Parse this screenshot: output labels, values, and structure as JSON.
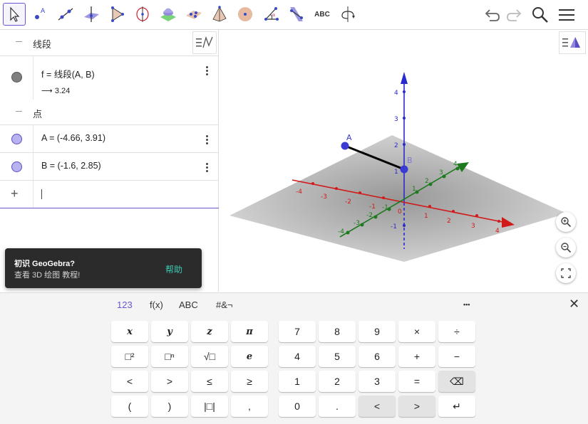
{
  "toolbar": {
    "tools": [
      {
        "name": "move-tool-icon",
        "label": ""
      },
      {
        "name": "point-tool-icon",
        "label": ""
      },
      {
        "name": "line-tool-icon",
        "label": ""
      },
      {
        "name": "perpendicular-tool-icon",
        "label": ""
      },
      {
        "name": "polygon-tool-icon",
        "label": ""
      },
      {
        "name": "circle-axis-tool-icon",
        "label": ""
      },
      {
        "name": "intersect-surfaces-tool-icon",
        "label": ""
      },
      {
        "name": "plane-tool-icon",
        "label": ""
      },
      {
        "name": "pyramid-tool-icon",
        "label": ""
      },
      {
        "name": "sphere-tool-icon",
        "label": ""
      },
      {
        "name": "angle-tool-icon",
        "label": ""
      },
      {
        "name": "reflect-tool-icon",
        "label": ""
      },
      {
        "name": "text-tool",
        "label": "ABC"
      },
      {
        "name": "rotate-view-tool-icon",
        "label": ""
      }
    ]
  },
  "algebra": {
    "group1_title": "线段",
    "segment_def": "f  =  线段(A, B)",
    "segment_value": "⟶  3.24",
    "group2_title": "点",
    "pointA": "A  =  (-4.66, 3.91)",
    "pointB": "B  =  (-1.6, 2.85)",
    "input_plus": "+"
  },
  "toast": {
    "title": "初识 GeoGebra?",
    "subtitle": "查看 3D 绘图 教程!",
    "action": "帮助"
  },
  "graphics": {
    "labelA": "A",
    "labelB": "B",
    "x_ticks": [
      "-4",
      "-3",
      "-2",
      "-1",
      "0",
      "1",
      "2",
      "3",
      "4"
    ],
    "y_ticks": [
      "-4",
      "-3",
      "-2",
      "-1",
      "1",
      "2",
      "3",
      "4"
    ],
    "z_ticks": [
      "-1",
      "1",
      "2",
      "3",
      "4"
    ]
  },
  "keyboard": {
    "tabs": [
      "123",
      "f(x)",
      "ABC",
      "#&¬"
    ],
    "more": "•••",
    "close": "✕",
    "left_keys": [
      [
        "x",
        "y",
        "z",
        "π"
      ],
      [
        "□²",
        "□ⁿ",
        "√□",
        "e"
      ],
      [
        "<",
        ">",
        "≤",
        "≥"
      ],
      [
        "(",
        ")",
        "|□|",
        ","
      ]
    ],
    "right_keys": [
      [
        "7",
        "8",
        "9",
        "×",
        "÷"
      ],
      [
        "4",
        "5",
        "6",
        "+",
        "−"
      ],
      [
        "1",
        "2",
        "3",
        "=",
        "⌫"
      ],
      [
        "0",
        ".",
        "<",
        ">",
        "↵"
      ]
    ]
  }
}
